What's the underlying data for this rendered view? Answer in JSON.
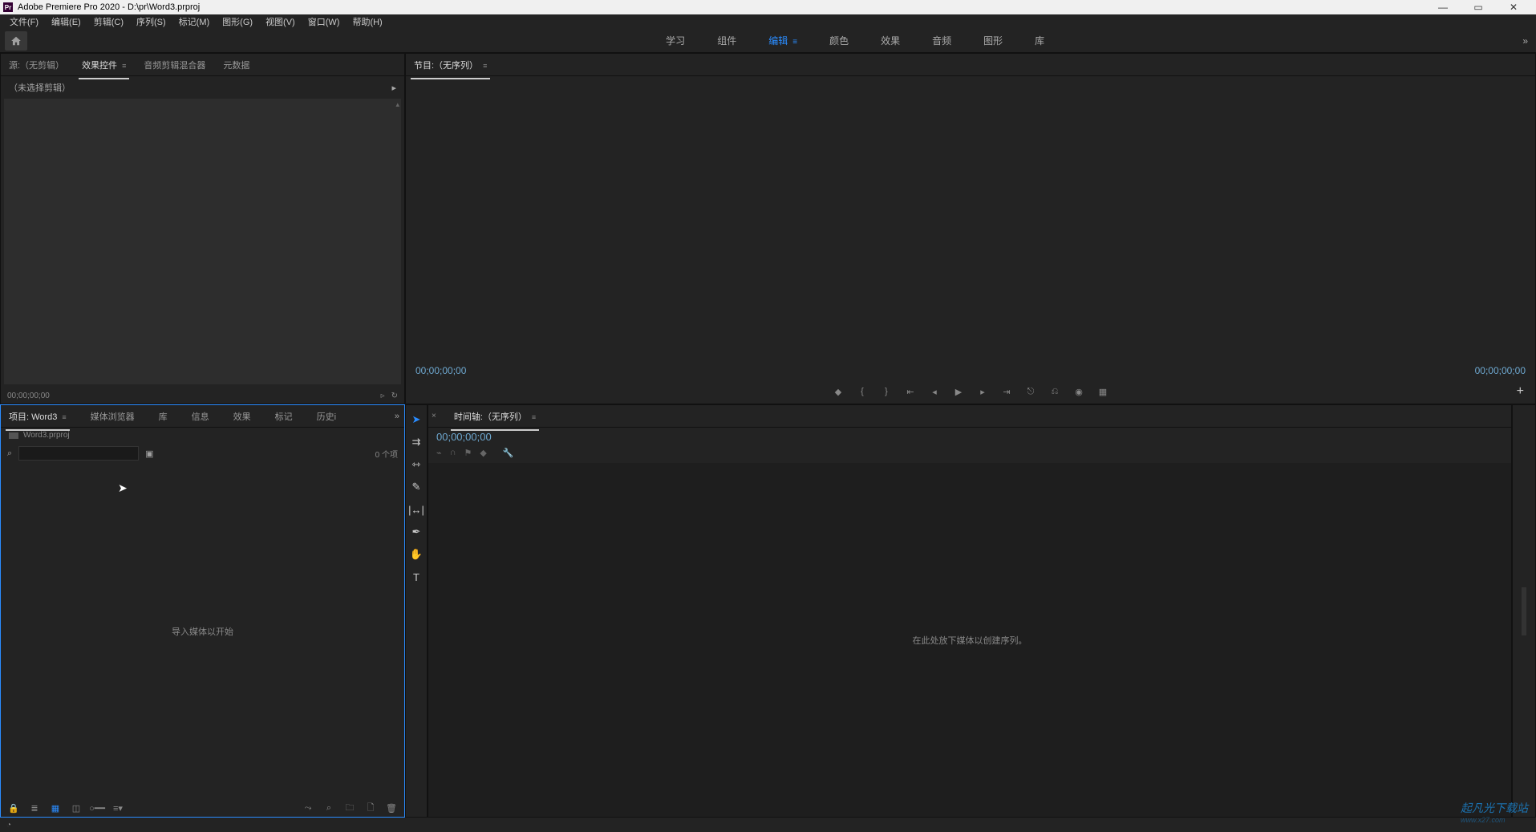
{
  "title": "Adobe Premiere Pro 2020 - D:\\pr\\Word3.prproj",
  "menubar": [
    "文件(F)",
    "编辑(E)",
    "剪辑(C)",
    "序列(S)",
    "标记(M)",
    "图形(G)",
    "视图(V)",
    "窗口(W)",
    "帮助(H)"
  ],
  "workspaces": {
    "items": [
      "学习",
      "组件",
      "编辑",
      "颜色",
      "效果",
      "音频",
      "图形",
      "库"
    ],
    "active_index": 2,
    "more": "»"
  },
  "source_panel": {
    "tabs": [
      "源:（无剪辑）",
      "效果控件",
      "音频剪辑混合器",
      "元数据"
    ],
    "active_index": 1,
    "header": "（未选择剪辑）",
    "timecode": "00;00;00;00"
  },
  "program_panel": {
    "title": "节目:（无序列）",
    "left_tc": "00;00;00;00",
    "right_tc": "00;00;00;00"
  },
  "project_panel": {
    "tabs": [
      "项目: Word3",
      "媒体浏览器",
      "库",
      "信息",
      "效果",
      "标记",
      "历史i"
    ],
    "active_index": 0,
    "more": "»",
    "project_file": "Word3.prproj",
    "item_count": "0 个项",
    "empty_hint": "导入媒体以开始"
  },
  "timeline_panel": {
    "title": "时间轴:（无序列）",
    "timecode": "00;00;00;00",
    "empty_hint": "在此处放下媒体以创建序列。"
  },
  "watermark": {
    "main": "起凡光下载站",
    "sub": "www.x27.com"
  }
}
